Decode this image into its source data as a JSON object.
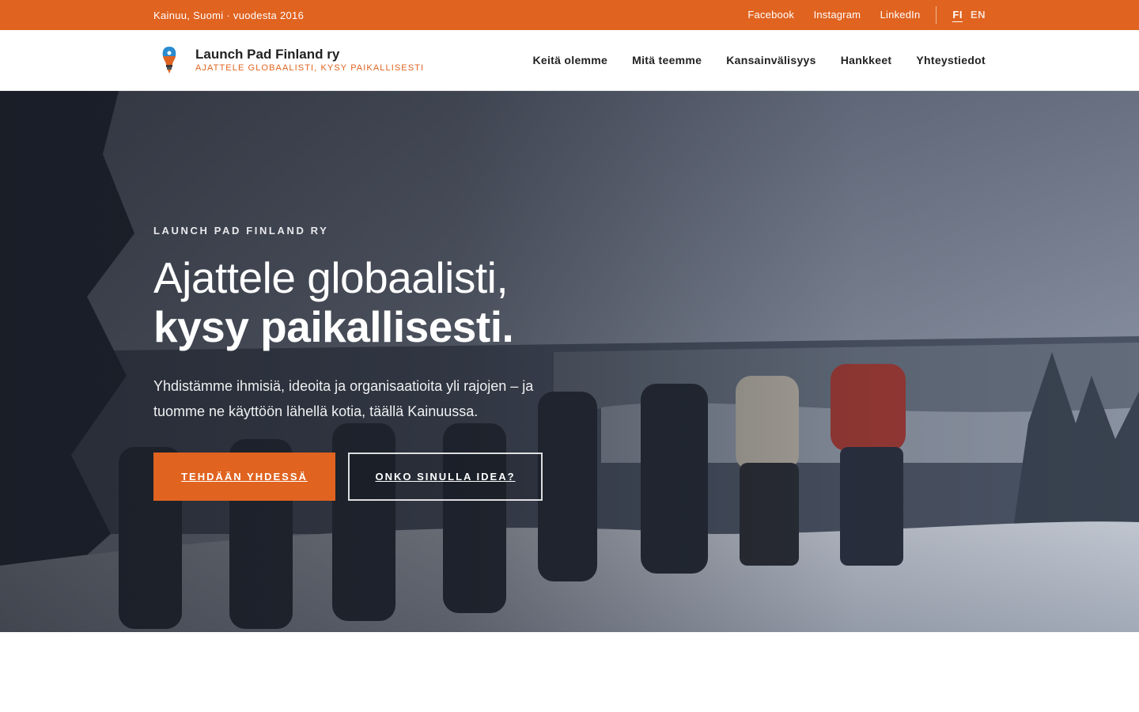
{
  "topbar": {
    "location": "Kainuu, Suomi · vuodesta 2016",
    "social": [
      "Facebook",
      "Instagram",
      "LinkedIn"
    ],
    "languages": {
      "active": "FI",
      "other": "EN"
    },
    "bg_color": "#e06320"
  },
  "header": {
    "brand_name": "Launch Pad Finland ry",
    "brand_tagline": "AJATTELE GLOBAALISTI, KYSY PAIKALLISESTI",
    "logo_icon": "lightbulb-rocket-icon",
    "nav": [
      "Keitä olemme",
      "Mitä teemme",
      "Kansainvälisyys",
      "Hankkeet",
      "Yhteystiedot"
    ]
  },
  "hero": {
    "eyebrow": "LAUNCH PAD FINLAND RY",
    "headline_line1": "Ajattele globaalisti,",
    "headline_line2": "kysy paikallisesti.",
    "lead": "Yhdistämme ihmisiä, ideoita ja organisaatioita yli rajojen – ja tuomme ne käyttöön lähellä kotia, täällä Kainuussa.",
    "primary_button": "TEHDÄÄN YHDESSÄ",
    "secondary_button": "ONKO SINULLA IDEA?",
    "accent_color": "#e06320"
  }
}
